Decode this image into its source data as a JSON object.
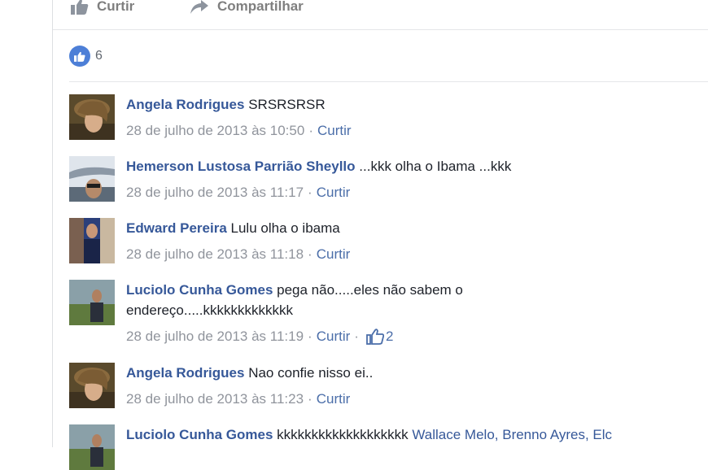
{
  "actions": {
    "like": "Curtir",
    "share": "Compartilhar"
  },
  "post": {
    "likes_count": "6"
  },
  "comments": [
    {
      "author": "Angela Rodrigues",
      "text": "SRSRSRSR",
      "timestamp": "28 de julho de 2013 às 10:50",
      "like_label": "Curtir"
    },
    {
      "author": "Hemerson Lustosa Parrião Sheyllo",
      "text": "...kkk olha o Ibama ...kkk",
      "timestamp": "28 de julho de 2013 às 11:17",
      "like_label": "Curtir"
    },
    {
      "author": "Edward Pereira",
      "text": "Lulu olha o ibama",
      "timestamp": "28 de julho de 2013 às 11:18",
      "like_label": "Curtir"
    },
    {
      "author": "Luciolo Cunha Gomes",
      "text": "pega não.....eles não sabem o endereço.....kkkkkkkkkkkkk",
      "timestamp": "28 de julho de 2013 às 11:19",
      "like_label": "Curtir",
      "reactions": "2"
    },
    {
      "author": "Angela Rodrigues",
      "text": "Nao confie nisso ei..",
      "timestamp": "28 de julho de 2013 às 11:23",
      "like_label": "Curtir"
    },
    {
      "author": "Luciolo Cunha Gomes",
      "text": "kkkkkkkkkkkkkkkkkkk",
      "tagged": "Wallace Melo, Brenno Ayres, Elc"
    }
  ],
  "colors": {
    "link": "#365899",
    "meta": "#90949c",
    "like_badge": "#4d7fd7"
  },
  "icons": {
    "like": "thumbs-up-icon",
    "share": "share-arrow-icon",
    "reaction": "thumbs-up-outline-icon"
  }
}
